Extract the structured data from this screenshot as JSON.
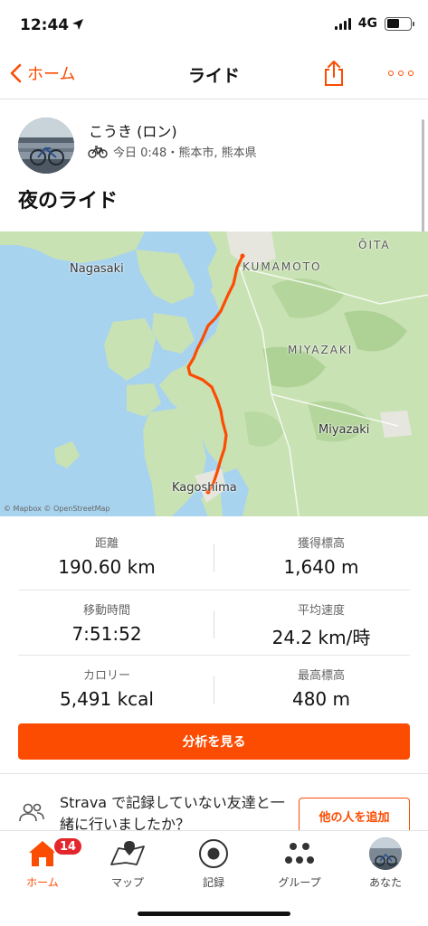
{
  "status_bar": {
    "time": "12:44",
    "network": "4G",
    "icons": [
      "location-arrow-icon",
      "signal-icon",
      "battery-icon"
    ]
  },
  "nav": {
    "back_label": "ホーム",
    "title": "ライド",
    "icons": [
      "chevron-left-icon",
      "share-icon",
      "more-icon"
    ]
  },
  "activity": {
    "athlete_name": "こうき (ロン)",
    "meta": "今日 0:48・熊本市, 熊本県",
    "title": "夜のライド",
    "sport_icon": "bike-icon"
  },
  "map": {
    "labels": {
      "nagasaki": "Nagasaki",
      "oita": "ŌITA",
      "kumamoto": "KUMAMOTO",
      "miyazaki_pref": "MIYAZAKI",
      "miyazaki_city": "Miyazaki",
      "kagoshima": "Kagoshima"
    },
    "attribution": "© Mapbox © OpenStreetMap",
    "route_color": "#fc4c02"
  },
  "stats": [
    {
      "label": "距離",
      "value": "190.60 km"
    },
    {
      "label": "獲得標高",
      "value": "1,640 m"
    },
    {
      "label": "移動時間",
      "value": "7:51:52"
    },
    {
      "label": "平均速度",
      "value": "24.2 km/時"
    },
    {
      "label": "カロリー",
      "value": "5,491 kcal"
    },
    {
      "label": "最高標高",
      "value": "480 m"
    }
  ],
  "analyze_button": "分析を見る",
  "friends_prompt": {
    "text": "Strava で記録していない友達と一緒に行いましたか？",
    "button": "他の人を追加"
  },
  "tabs": [
    {
      "label": "ホーム",
      "icon": "home-icon",
      "badge": "14",
      "active": true
    },
    {
      "label": "マップ",
      "icon": "map-icon"
    },
    {
      "label": "記録",
      "icon": "record-icon"
    },
    {
      "label": "グループ",
      "icon": "groups-icon"
    },
    {
      "label": "あなた",
      "icon": "profile-avatar"
    }
  ],
  "colors": {
    "accent": "#fc4c02",
    "badge": "#e3262c"
  }
}
